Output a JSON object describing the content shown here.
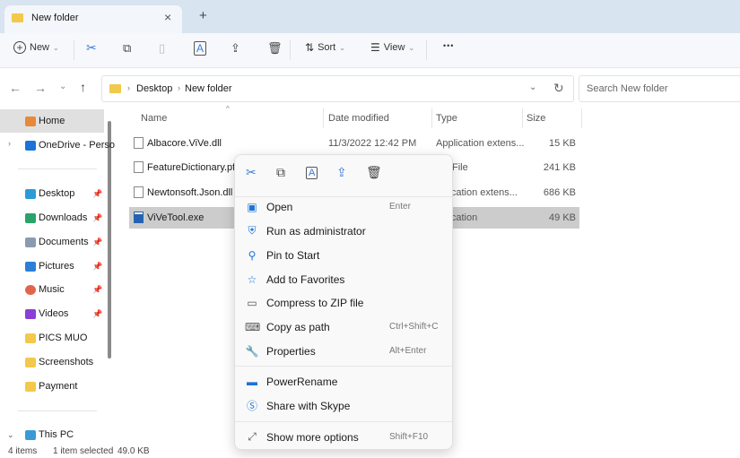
{
  "tab": {
    "title": "New folder",
    "close": "×",
    "new_tab": "+"
  },
  "toolbar": {
    "new_label": "New",
    "sort_label": "Sort",
    "view_label": "View",
    "more": "•••"
  },
  "nav": {
    "breadcrumb": [
      "Desktop",
      "New folder"
    ],
    "search_placeholder": "Search New folder"
  },
  "sidebar": {
    "items": [
      {
        "label": "Home",
        "icon": "home-icon",
        "color": "#e8883a"
      },
      {
        "label": "OneDrive - Perso",
        "icon": "cloud-icon",
        "color": "#1a73d8"
      },
      {
        "label": "Desktop",
        "icon": "desktop-icon",
        "color": "#2d9ad8",
        "pinned": true
      },
      {
        "label": "Downloads",
        "icon": "download-icon",
        "color": "#2aa36a",
        "pinned": true
      },
      {
        "label": "Documents",
        "icon": "document-icon",
        "color": "#8a9ab0",
        "pinned": true
      },
      {
        "label": "Pictures",
        "icon": "pictures-icon",
        "color": "#2b7fd6",
        "pinned": true
      },
      {
        "label": "Music",
        "icon": "music-icon",
        "color": "#e0654b",
        "pinned": true
      },
      {
        "label": "Videos",
        "icon": "videos-icon",
        "color": "#8a3fd6",
        "pinned": true
      },
      {
        "label": "PICS MUO",
        "icon": "folder-icon",
        "color": "#f2c94c"
      },
      {
        "label": "Screenshots",
        "icon": "folder-icon",
        "color": "#f2c94c"
      },
      {
        "label": "Payment",
        "icon": "folder-icon",
        "color": "#f2c94c"
      },
      {
        "label": "This PC",
        "icon": "computer-icon",
        "color": "#3a9ad8"
      }
    ]
  },
  "columns": {
    "name": "Name",
    "date": "Date modified",
    "type": "Type",
    "size": "Size"
  },
  "files": [
    {
      "name": "Albacore.ViVe.dll",
      "date": "11/3/2022 12:42 PM",
      "type": "Application extens...",
      "size": "15 KB"
    },
    {
      "name": "FeatureDictionary.pfs",
      "date": "",
      "type": "File",
      "size": "241 KB"
    },
    {
      "name": "Newtonsoft.Json.dll",
      "date": "",
      "type": "lication extens...",
      "size": "686 KB"
    },
    {
      "name": "ViVeTool.exe",
      "date": "",
      "type": "lication",
      "size": "49 KB",
      "selected": true
    }
  ],
  "context_menu": {
    "quick_actions": [
      "cut-icon",
      "copy-icon",
      "rename-icon",
      "share-icon",
      "delete-icon"
    ],
    "items": [
      {
        "label": "Open",
        "shortcut": "Enter",
        "icon": "app-icon"
      },
      {
        "label": "Run as administrator",
        "shortcut": "",
        "icon": "shield-icon"
      },
      {
        "label": "Pin to Start",
        "shortcut": "",
        "icon": "pin-icon"
      },
      {
        "label": "Add to Favorites",
        "shortcut": "",
        "icon": "star-icon"
      },
      {
        "label": "Compress to ZIP file",
        "shortcut": "",
        "icon": "zip-icon"
      },
      {
        "label": "Copy as path",
        "shortcut": "Ctrl+Shift+C",
        "icon": "path-icon"
      },
      {
        "label": "Properties",
        "shortcut": "Alt+Enter",
        "icon": "wrench-icon"
      },
      {
        "label": "PowerRename",
        "shortcut": "",
        "icon": "powerrename-icon"
      },
      {
        "label": "Share with Skype",
        "shortcut": "",
        "icon": "skype-icon"
      },
      {
        "label": "Show more options",
        "shortcut": "Shift+F10",
        "icon": "expand-icon"
      }
    ]
  },
  "status": {
    "count": "4 items",
    "selection": "1 item selected",
    "size": "49.0 KB"
  },
  "colors": {
    "selected_row": "#cccccc",
    "accent": "#0067c0"
  }
}
